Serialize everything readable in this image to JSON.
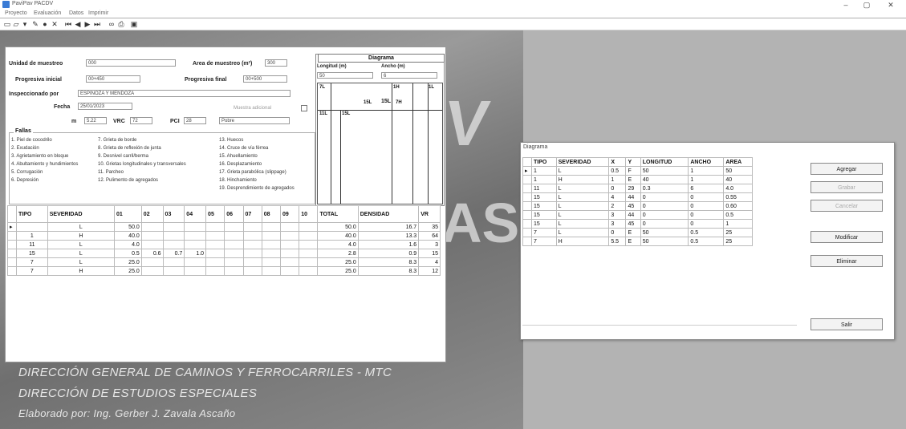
{
  "window": {
    "title": "PaviPav  PACDV",
    "min": "–",
    "max": "▢",
    "close": "✕"
  },
  "menu": [
    "Proyecto",
    "Evaluación",
    "Datos",
    "Imprimir"
  ],
  "toolbar_icons": [
    "new-icon",
    "open-icon",
    "save-icon",
    "first-icon",
    "prev-icon",
    "next-icon",
    "last-icon",
    "add-icon",
    "delete-icon",
    "edit-icon",
    "cancel-icon",
    "binoculars-icon",
    "print-icon",
    "preview-icon",
    "print-setup-icon"
  ],
  "form": {
    "unidad_label": "Unidad de muestreo",
    "unidad_value": "000",
    "area_label": "Area de muestreo (m²)",
    "area_value": "300",
    "prog_ini_label": "Progresiva inicial",
    "prog_ini_value": "00+450",
    "prog_fin_label": "Progresiva final",
    "prog_fin_value": "00+500",
    "insp_label": "Inspeccionado por",
    "insp_value": "ESPINOZA Y MENDOZA",
    "fecha_label": "Fecha",
    "fecha_value": "25/01/2023",
    "muestra_label": "Muestra adicional",
    "m_label": "m",
    "m_value": "5.22",
    "vrc_label": "VRC",
    "vrc_value": "72",
    "pci_label": "PCI",
    "pci_value": "28",
    "cond_value": "Pobre",
    "fallas_title": "Fallas",
    "fallas": [
      "1. Piel de cocodrilo",
      "2. Exudación",
      "3. Agrietamiento en bloque",
      "4. Abultamiento y hundimientos",
      "5. Corrugación",
      "6. Depresión",
      "7. Grieta de borde",
      "8. Grieta de reflexión de junta",
      "9. Desnivel carril/berma",
      "10. Grietas longitudinales y transversales",
      "11. Parcheo",
      "12. Pulimento de agregados",
      "13. Huecos",
      "14. Cruce de vía férrea",
      "15. Ahuellamiento",
      "16. Desplazamiento",
      "17. Grieta parabólica (slippage)",
      "18. Hinchamiento",
      "19. Desprendimiento de agregados"
    ],
    "diagrama": {
      "title": "Diagrama",
      "longitud_label": "Longitud (m)",
      "ancho_label": "Ancho (m)",
      "longitud_value": "50",
      "ancho_value": "6",
      "labels": [
        "7L",
        "1H",
        "1L",
        "15L",
        "15L",
        "7H",
        "11L",
        "15L",
        "7H"
      ]
    },
    "table": {
      "headers": [
        "TIPO",
        "SEVERIDAD",
        "01",
        "02",
        "03",
        "04",
        "05",
        "06",
        "07",
        "08",
        "09",
        "10",
        "TOTAL",
        "DENSIDAD",
        "VR"
      ],
      "rows": [
        [
          "",
          "L",
          "50.0",
          "",
          "",
          "",
          "",
          "",
          "",
          "",
          "",
          "",
          "50.0",
          "16.7",
          "35"
        ],
        [
          "1",
          "H",
          "40.0",
          "",
          "",
          "",
          "",
          "",
          "",
          "",
          "",
          "",
          "40.0",
          "13.3",
          "64"
        ],
        [
          "11",
          "L",
          "4.0",
          "",
          "",
          "",
          "",
          "",
          "",
          "",
          "",
          "",
          "4.0",
          "1.6",
          "3"
        ],
        [
          "15",
          "L",
          "0.5",
          "0.6",
          "0.7",
          "1.0",
          "",
          "",
          "",
          "",
          "",
          "",
          "2.8",
          "0.9",
          "15"
        ],
        [
          "7",
          "L",
          "25.0",
          "",
          "",
          "",
          "",
          "",
          "",
          "",
          "",
          "",
          "25.0",
          "8.3",
          "4"
        ],
        [
          "7",
          "H",
          "25.0",
          "",
          "",
          "",
          "",
          "",
          "",
          "",
          "",
          "",
          "25.0",
          "8.3",
          "12"
        ]
      ]
    }
  },
  "dialog": {
    "title": "Diagrama",
    "headers": [
      "TIPO",
      "SEVERIDAD",
      "X",
      "Y",
      "LONGITUD",
      "ANCHO",
      "AREA"
    ],
    "rows": [
      [
        "1",
        "L",
        "0.5",
        "F",
        "50",
        "1",
        "50"
      ],
      [
        "1",
        "H",
        "1",
        "E",
        "40",
        "1",
        "40"
      ],
      [
        "11",
        "L",
        "0",
        "29",
        "0.3",
        "6",
        "4.0"
      ],
      [
        "15",
        "L",
        "4",
        "44",
        "0",
        "0",
        "0.55"
      ],
      [
        "15",
        "L",
        "2",
        "45",
        "0",
        "0",
        "0.60"
      ],
      [
        "15",
        "L",
        "3",
        "44",
        "0",
        "0",
        "0.5"
      ],
      [
        "15",
        "L",
        "3",
        "45",
        "0",
        "0",
        "1"
      ],
      [
        "7",
        "L",
        "0",
        "E",
        "50",
        "0.5",
        "25"
      ],
      [
        "7",
        "H",
        "5.5",
        "E",
        "50",
        "0.5",
        "25"
      ]
    ],
    "buttons": {
      "agregar": "Agregar",
      "grabar": "Grabar",
      "cancelar": "Cancelar",
      "modificar": "Modificar",
      "eliminar": "Eliminar",
      "salir": "Salir"
    }
  },
  "background": {
    "credit1": "DIRECCIÓN GENERAL DE CAMINOS Y FERROCARRILES - MTC",
    "credit2": "DIRECCIÓN DE ESTUDIOS ESPECIALES",
    "credit3": "Elaborado por: Ing. Gerber J. Zavala Ascaño"
  }
}
